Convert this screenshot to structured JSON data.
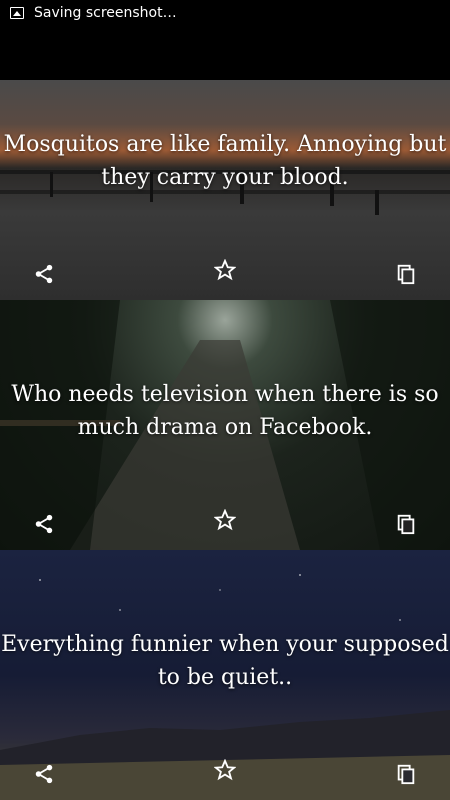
{
  "statusbar": {
    "notification_text": "Saving screenshot…"
  },
  "quotes": [
    {
      "text": "Mosquitos are like family. Annoying but they carry your blood."
    },
    {
      "text": "Who needs television when there is so much drama on Facebook."
    },
    {
      "text": "Everything funnier when your supposed to be quiet.."
    }
  ],
  "icons": {
    "notification": "image-icon",
    "share": "share-icon",
    "favorite": "star-outline-icon",
    "copy": "copy-icon"
  }
}
